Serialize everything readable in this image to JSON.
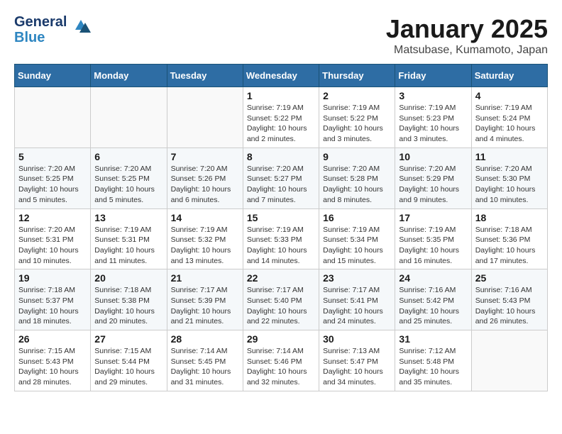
{
  "header": {
    "logo_line1": "General",
    "logo_line2": "Blue",
    "title": "January 2025",
    "subtitle": "Matsubase, Kumamoto, Japan"
  },
  "weekdays": [
    "Sunday",
    "Monday",
    "Tuesday",
    "Wednesday",
    "Thursday",
    "Friday",
    "Saturday"
  ],
  "weeks": [
    [
      {
        "day": "",
        "sunrise": "",
        "sunset": "",
        "daylight": ""
      },
      {
        "day": "",
        "sunrise": "",
        "sunset": "",
        "daylight": ""
      },
      {
        "day": "",
        "sunrise": "",
        "sunset": "",
        "daylight": ""
      },
      {
        "day": "1",
        "sunrise": "Sunrise: 7:19 AM",
        "sunset": "Sunset: 5:22 PM",
        "daylight": "Daylight: 10 hours and 2 minutes."
      },
      {
        "day": "2",
        "sunrise": "Sunrise: 7:19 AM",
        "sunset": "Sunset: 5:22 PM",
        "daylight": "Daylight: 10 hours and 3 minutes."
      },
      {
        "day": "3",
        "sunrise": "Sunrise: 7:19 AM",
        "sunset": "Sunset: 5:23 PM",
        "daylight": "Daylight: 10 hours and 3 minutes."
      },
      {
        "day": "4",
        "sunrise": "Sunrise: 7:19 AM",
        "sunset": "Sunset: 5:24 PM",
        "daylight": "Daylight: 10 hours and 4 minutes."
      }
    ],
    [
      {
        "day": "5",
        "sunrise": "Sunrise: 7:20 AM",
        "sunset": "Sunset: 5:25 PM",
        "daylight": "Daylight: 10 hours and 5 minutes."
      },
      {
        "day": "6",
        "sunrise": "Sunrise: 7:20 AM",
        "sunset": "Sunset: 5:25 PM",
        "daylight": "Daylight: 10 hours and 5 minutes."
      },
      {
        "day": "7",
        "sunrise": "Sunrise: 7:20 AM",
        "sunset": "Sunset: 5:26 PM",
        "daylight": "Daylight: 10 hours and 6 minutes."
      },
      {
        "day": "8",
        "sunrise": "Sunrise: 7:20 AM",
        "sunset": "Sunset: 5:27 PM",
        "daylight": "Daylight: 10 hours and 7 minutes."
      },
      {
        "day": "9",
        "sunrise": "Sunrise: 7:20 AM",
        "sunset": "Sunset: 5:28 PM",
        "daylight": "Daylight: 10 hours and 8 minutes."
      },
      {
        "day": "10",
        "sunrise": "Sunrise: 7:20 AM",
        "sunset": "Sunset: 5:29 PM",
        "daylight": "Daylight: 10 hours and 9 minutes."
      },
      {
        "day": "11",
        "sunrise": "Sunrise: 7:20 AM",
        "sunset": "Sunset: 5:30 PM",
        "daylight": "Daylight: 10 hours and 10 minutes."
      }
    ],
    [
      {
        "day": "12",
        "sunrise": "Sunrise: 7:20 AM",
        "sunset": "Sunset: 5:31 PM",
        "daylight": "Daylight: 10 hours and 10 minutes."
      },
      {
        "day": "13",
        "sunrise": "Sunrise: 7:19 AM",
        "sunset": "Sunset: 5:31 PM",
        "daylight": "Daylight: 10 hours and 11 minutes."
      },
      {
        "day": "14",
        "sunrise": "Sunrise: 7:19 AM",
        "sunset": "Sunset: 5:32 PM",
        "daylight": "Daylight: 10 hours and 13 minutes."
      },
      {
        "day": "15",
        "sunrise": "Sunrise: 7:19 AM",
        "sunset": "Sunset: 5:33 PM",
        "daylight": "Daylight: 10 hours and 14 minutes."
      },
      {
        "day": "16",
        "sunrise": "Sunrise: 7:19 AM",
        "sunset": "Sunset: 5:34 PM",
        "daylight": "Daylight: 10 hours and 15 minutes."
      },
      {
        "day": "17",
        "sunrise": "Sunrise: 7:19 AM",
        "sunset": "Sunset: 5:35 PM",
        "daylight": "Daylight: 10 hours and 16 minutes."
      },
      {
        "day": "18",
        "sunrise": "Sunrise: 7:18 AM",
        "sunset": "Sunset: 5:36 PM",
        "daylight": "Daylight: 10 hours and 17 minutes."
      }
    ],
    [
      {
        "day": "19",
        "sunrise": "Sunrise: 7:18 AM",
        "sunset": "Sunset: 5:37 PM",
        "daylight": "Daylight: 10 hours and 18 minutes."
      },
      {
        "day": "20",
        "sunrise": "Sunrise: 7:18 AM",
        "sunset": "Sunset: 5:38 PM",
        "daylight": "Daylight: 10 hours and 20 minutes."
      },
      {
        "day": "21",
        "sunrise": "Sunrise: 7:17 AM",
        "sunset": "Sunset: 5:39 PM",
        "daylight": "Daylight: 10 hours and 21 minutes."
      },
      {
        "day": "22",
        "sunrise": "Sunrise: 7:17 AM",
        "sunset": "Sunset: 5:40 PM",
        "daylight": "Daylight: 10 hours and 22 minutes."
      },
      {
        "day": "23",
        "sunrise": "Sunrise: 7:17 AM",
        "sunset": "Sunset: 5:41 PM",
        "daylight": "Daylight: 10 hours and 24 minutes."
      },
      {
        "day": "24",
        "sunrise": "Sunrise: 7:16 AM",
        "sunset": "Sunset: 5:42 PM",
        "daylight": "Daylight: 10 hours and 25 minutes."
      },
      {
        "day": "25",
        "sunrise": "Sunrise: 7:16 AM",
        "sunset": "Sunset: 5:43 PM",
        "daylight": "Daylight: 10 hours and 26 minutes."
      }
    ],
    [
      {
        "day": "26",
        "sunrise": "Sunrise: 7:15 AM",
        "sunset": "Sunset: 5:43 PM",
        "daylight": "Daylight: 10 hours and 28 minutes."
      },
      {
        "day": "27",
        "sunrise": "Sunrise: 7:15 AM",
        "sunset": "Sunset: 5:44 PM",
        "daylight": "Daylight: 10 hours and 29 minutes."
      },
      {
        "day": "28",
        "sunrise": "Sunrise: 7:14 AM",
        "sunset": "Sunset: 5:45 PM",
        "daylight": "Daylight: 10 hours and 31 minutes."
      },
      {
        "day": "29",
        "sunrise": "Sunrise: 7:14 AM",
        "sunset": "Sunset: 5:46 PM",
        "daylight": "Daylight: 10 hours and 32 minutes."
      },
      {
        "day": "30",
        "sunrise": "Sunrise: 7:13 AM",
        "sunset": "Sunset: 5:47 PM",
        "daylight": "Daylight: 10 hours and 34 minutes."
      },
      {
        "day": "31",
        "sunrise": "Sunrise: 7:12 AM",
        "sunset": "Sunset: 5:48 PM",
        "daylight": "Daylight: 10 hours and 35 minutes."
      },
      {
        "day": "",
        "sunrise": "",
        "sunset": "",
        "daylight": ""
      }
    ]
  ]
}
